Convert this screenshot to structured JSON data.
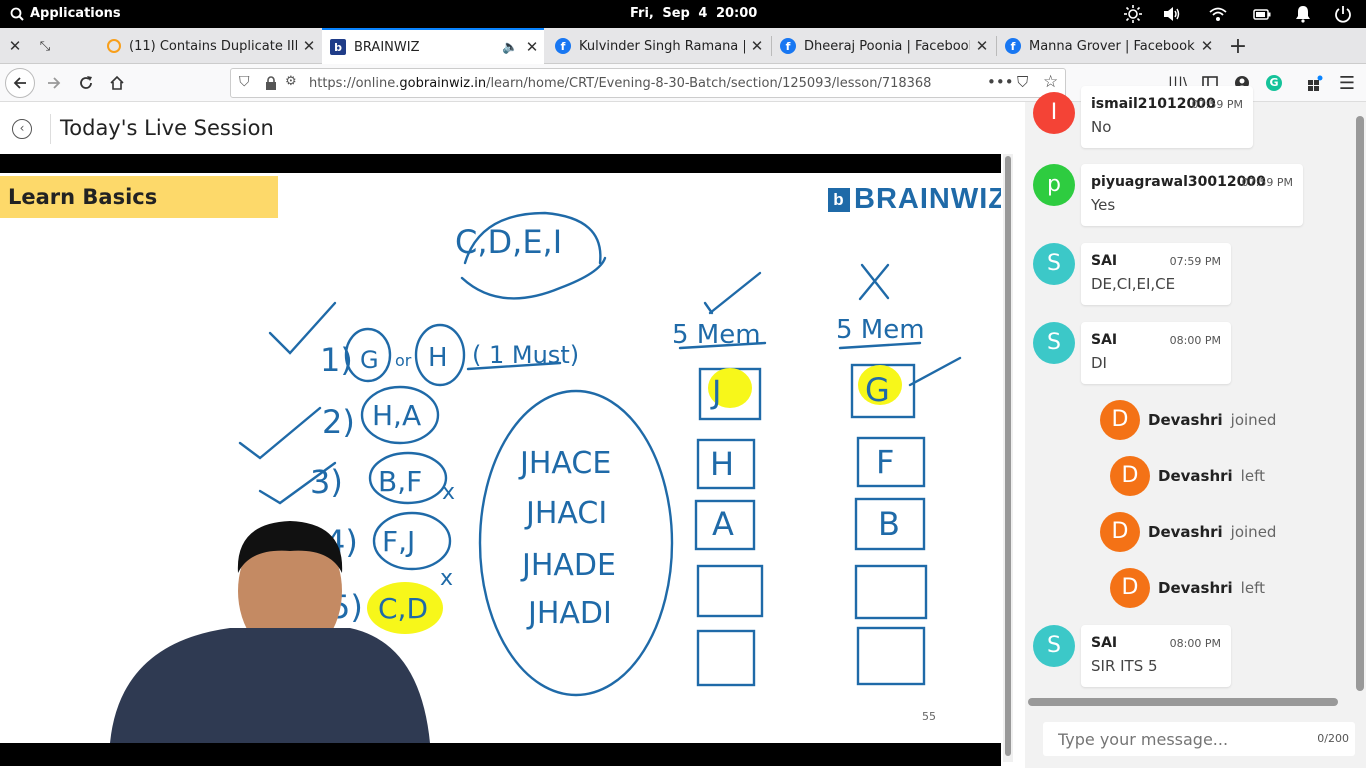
{
  "topbar": {
    "apps_label": "Applications",
    "clock": "Fri, Sep  4   20:00"
  },
  "tabs": [
    {
      "title": "(11) Contains Duplicate III - Le"
    },
    {
      "title": "BRAINWIZ"
    },
    {
      "title": "Kulvinder Singh Ramana | Fa"
    },
    {
      "title": "Dheeraj Poonia | Facebook"
    },
    {
      "title": "Manna Grover | Facebook"
    }
  ],
  "nav": {
    "url_prefix": "https://online.",
    "url_domain": "gobrainwiz.in",
    "url_path": "/learn/home/CRT/Evening-8-30-Batch/section/125093/lesson/718368"
  },
  "page": {
    "title": "Today's Live Session"
  },
  "video": {
    "banner": "Learn Basics",
    "logo": "BRAINWIZ",
    "page_number": "55"
  },
  "chat": {
    "messages": [
      {
        "avatar": "I",
        "user": "ismail21012000",
        "time": "07:59 PM",
        "text": "No"
      },
      {
        "avatar": "p",
        "user": "piyuagrawal30012000",
        "time": "07:59 PM",
        "text": "Yes"
      },
      {
        "avatar": "S",
        "user": "SAI",
        "time": "07:59 PM",
        "text": "DE,CI,EI,CE"
      },
      {
        "avatar": "S",
        "user": "SAI",
        "time": "08:00 PM",
        "text": "DI"
      },
      {
        "avatar": "S",
        "user": "SAI",
        "time": "08:00 PM",
        "text": "SIR ITS 5"
      }
    ],
    "events": [
      {
        "avatar": "D",
        "name": "Devashri",
        "status": "joined"
      },
      {
        "avatar": "D",
        "name": "Devashri",
        "status": "left"
      },
      {
        "avatar": "D",
        "name": "Devashri",
        "status": "joined"
      },
      {
        "avatar": "D",
        "name": "Devashri",
        "status": "left"
      }
    ],
    "input_placeholder": "Type your message...",
    "char_count": "0/200"
  },
  "colors": {
    "accent": "#0a84ff",
    "brand": "#1f6aa8",
    "banner": "#fdd96a",
    "avatar_red": "#f44336",
    "avatar_green": "#2ecc40",
    "avatar_teal": "#3cc8c8",
    "avatar_orange": "#f47216",
    "ink": "#1f6aa8",
    "highlight": "#f7f71a"
  }
}
